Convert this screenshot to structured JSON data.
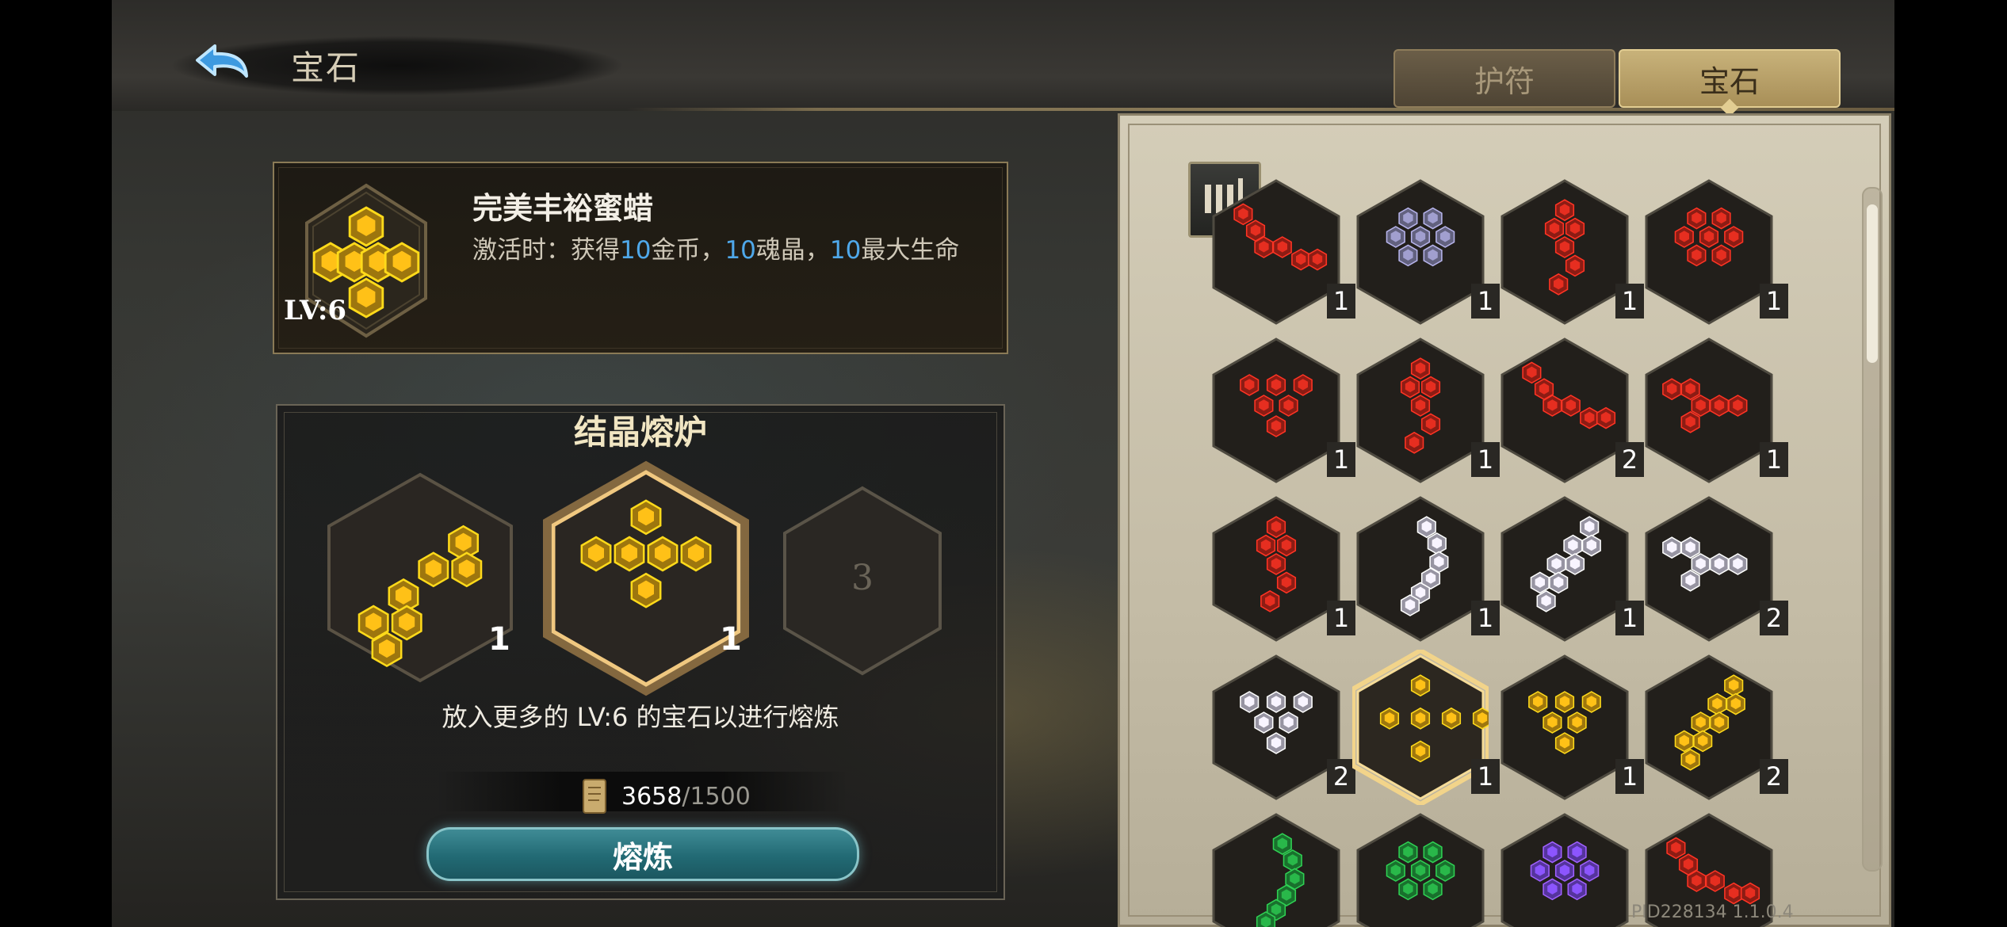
{
  "header": {
    "title": "宝石",
    "tabs": [
      {
        "label": "护符",
        "active": false
      },
      {
        "label": "宝石",
        "active": true
      }
    ]
  },
  "selected_gem": {
    "name": "完美丰裕蜜蜡",
    "level": "LV:6",
    "desc_prefix": "激活时：获得",
    "desc_v1": "10",
    "desc_t1": "金币，",
    "desc_v2": "10",
    "desc_t2": "魂晶，",
    "desc_v3": "10",
    "desc_t3": "最大生命",
    "color": "gold"
  },
  "furnace": {
    "title": "结晶熔炉",
    "slots": [
      {
        "count": "1",
        "color": "gold",
        "icon": "gem-cluster-icon"
      },
      {
        "count": "1",
        "color": "gold",
        "icon": "gem-cluster-icon",
        "highlighted": true
      },
      {
        "empty_number": "3"
      }
    ],
    "hint": "放入更多的 LV:6 的宝石以进行熔炼",
    "cost_current": "3658",
    "cost_max": "/1500",
    "cost_icon": "scroll-icon",
    "smelt_label": "熔炼"
  },
  "inventory": {
    "rows": [
      [
        {
          "color": "red",
          "count": "1"
        },
        {
          "color": "lavender",
          "count": "1"
        },
        {
          "color": "red",
          "count": "1"
        },
        {
          "color": "red",
          "count": "1"
        }
      ],
      [
        {
          "color": "red",
          "count": "1"
        },
        {
          "color": "red",
          "count": "1"
        },
        {
          "color": "red",
          "count": "2"
        },
        {
          "color": "red",
          "count": "1"
        }
      ],
      [
        {
          "color": "red",
          "count": "1"
        },
        {
          "color": "white",
          "count": "1"
        },
        {
          "color": "white",
          "count": "1"
        },
        {
          "color": "white",
          "count": "2"
        }
      ],
      [
        {
          "color": "white",
          "count": "2"
        },
        {
          "color": "gold",
          "count": "1",
          "selected": true
        },
        {
          "color": "gold",
          "count": "1"
        },
        {
          "color": "gold",
          "count": "2"
        }
      ],
      [
        {
          "color": "green",
          "count": ""
        },
        {
          "color": "green",
          "count": ""
        },
        {
          "color": "purple",
          "count": ""
        },
        {
          "color": "red",
          "count": ""
        }
      ]
    ]
  },
  "colors": {
    "gold": "#e0a814",
    "red": "#c8281c",
    "lavender": "#8c8ab4",
    "white": "#d8d4e8",
    "green": "#24a040",
    "purple": "#7a4ae0",
    "accent_blue": "#4fa8ea"
  },
  "footer": {
    "build": "PID228134  1.1.0.4"
  }
}
